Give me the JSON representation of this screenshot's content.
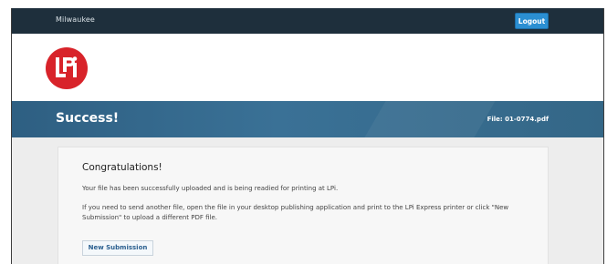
{
  "topbar": {
    "location": "Milwaukee",
    "logout_label": "Logout"
  },
  "logo": {
    "text": "LPi",
    "color": "#d8232a"
  },
  "banner": {
    "title": "Success!",
    "file_label": "File: 01-0774.pdf"
  },
  "card": {
    "heading": "Congratulations!",
    "message_1": "Your file has been successfully uploaded and is being readied for printing at LPi.",
    "message_2": "If you need to send another file, open the file in your desktop publishing application and print to the LPi Express printer or click \"New Submission\" to upload a different PDF file.",
    "new_submission_label": "New Submission"
  },
  "colors": {
    "topbar_bg": "#1e2f3c",
    "accent_button": "#2b8fd2",
    "banner_bg": "#356989",
    "brand_red": "#d8232a"
  }
}
